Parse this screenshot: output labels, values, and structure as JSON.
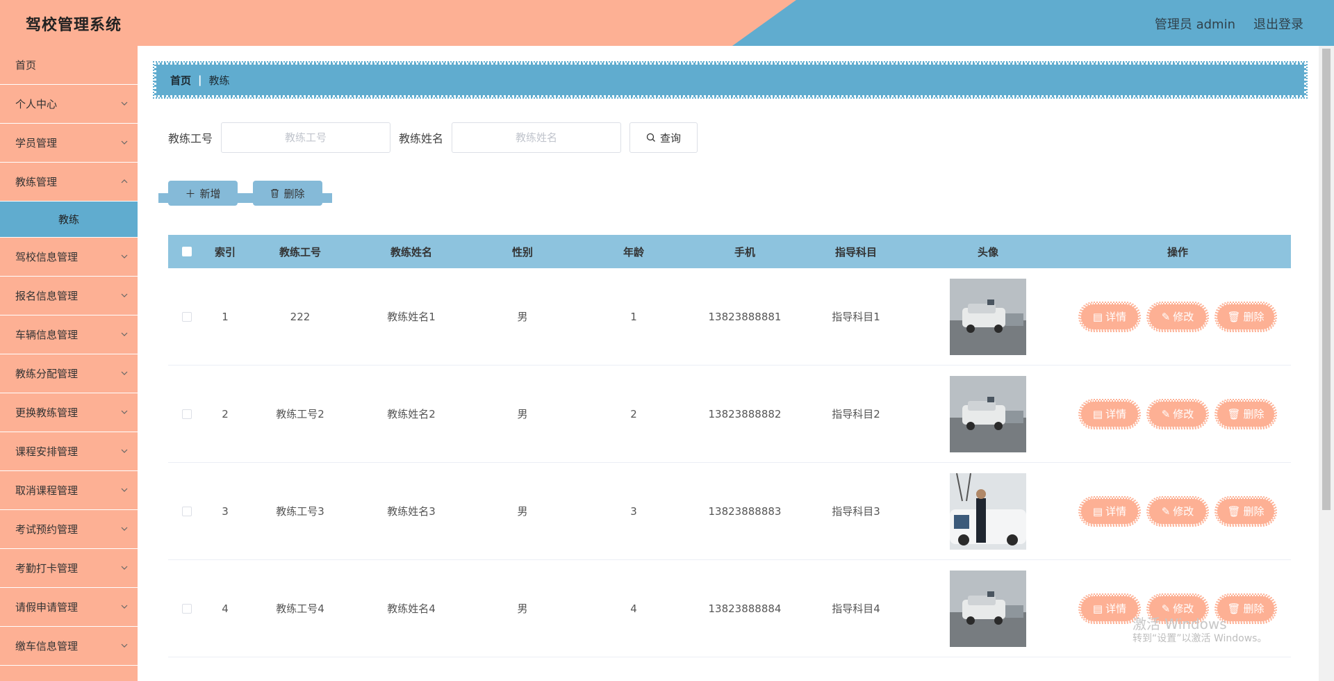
{
  "header": {
    "title": "驾校管理系统",
    "user_label": "管理员 admin",
    "logout_label": "退出登录"
  },
  "sidebar": {
    "items": [
      {
        "label": "首页"
      },
      {
        "label": "个人中心"
      },
      {
        "label": "学员管理"
      },
      {
        "label": "教练管理"
      },
      {
        "label": "驾校信息管理"
      },
      {
        "label": "报名信息管理"
      },
      {
        "label": "车辆信息管理"
      },
      {
        "label": "教练分配管理"
      },
      {
        "label": "更换教练管理"
      },
      {
        "label": "课程安排管理"
      },
      {
        "label": "取消课程管理"
      },
      {
        "label": "考试预约管理"
      },
      {
        "label": "考勤打卡管理"
      },
      {
        "label": "请假申请管理"
      },
      {
        "label": "缴车信息管理"
      }
    ],
    "active_sub": "教练"
  },
  "breadcrumb": {
    "home": "首页",
    "current": "教练"
  },
  "search": {
    "no_label": "教练工号",
    "no_placeholder": "教练工号",
    "name_label": "教练姓名",
    "name_placeholder": "教练姓名",
    "query_label": "查询"
  },
  "actions": {
    "add_label": "新增",
    "delete_label": "删除"
  },
  "table": {
    "headers": {
      "index": "索引",
      "no": "教练工号",
      "name": "教练姓名",
      "sex": "性别",
      "age": "年龄",
      "phone": "手机",
      "subject": "指导科目",
      "avatar": "头像",
      "ops": "操作"
    },
    "rows": [
      {
        "index": "1",
        "no": "222",
        "name": "教练姓名1",
        "sex": "男",
        "age": "1",
        "phone": "13823888881",
        "subject": "指导科目1"
      },
      {
        "index": "2",
        "no": "教练工号2",
        "name": "教练姓名2",
        "sex": "男",
        "age": "2",
        "phone": "13823888882",
        "subject": "指导科目2"
      },
      {
        "index": "3",
        "no": "教练工号3",
        "name": "教练姓名3",
        "sex": "男",
        "age": "3",
        "phone": "13823888883",
        "subject": "指导科目3"
      },
      {
        "index": "4",
        "no": "教练工号4",
        "name": "教练姓名4",
        "sex": "男",
        "age": "4",
        "phone": "13823888884",
        "subject": "指导科目4"
      }
    ],
    "op_labels": {
      "detail": "详情",
      "edit": "修改",
      "delete": "删除"
    }
  },
  "watermark": {
    "line1": "激活 Windows",
    "line2": "转到“设置”以激活 Windows。"
  },
  "colors": {
    "peach": "#fdb094",
    "blue": "#60accf",
    "table_header": "#8dc3de"
  }
}
